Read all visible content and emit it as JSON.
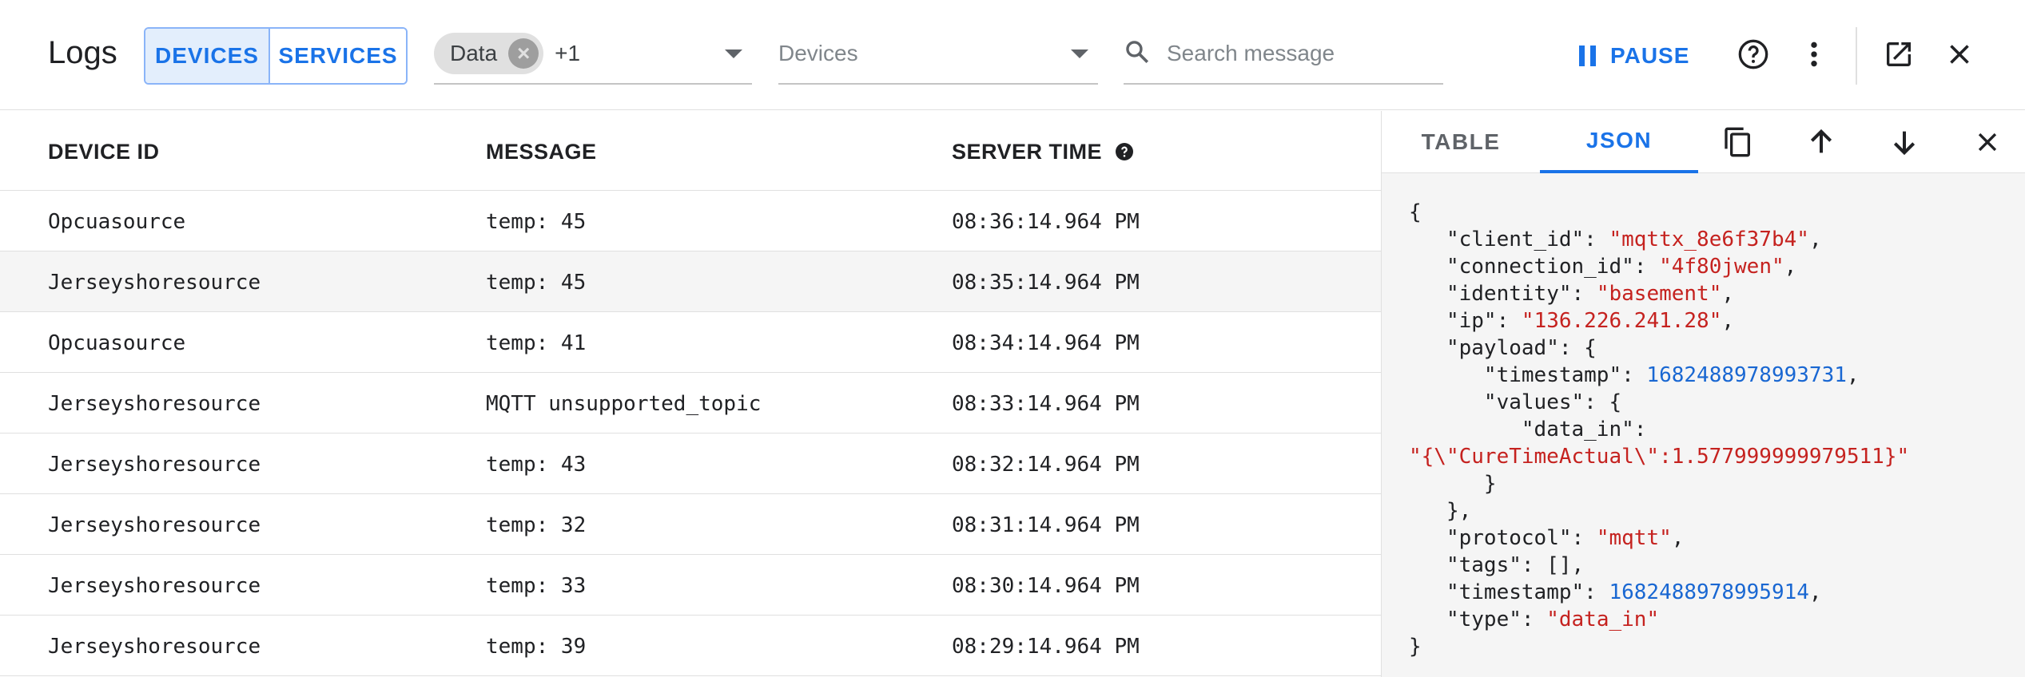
{
  "header": {
    "title": "Logs",
    "toggle": {
      "devices_label": "DEVICES",
      "services_label": "SERVICES",
      "active": "DEVICES"
    },
    "type_filter": {
      "chip_label": "Data",
      "more_count": "+1"
    },
    "device_filter": {
      "placeholder": "Devices"
    },
    "search": {
      "placeholder": "Search message"
    },
    "pause_label": "PAUSE",
    "icons": [
      "help-icon",
      "more-vert-icon",
      "open-in-new-icon",
      "close-icon"
    ]
  },
  "table": {
    "columns": [
      "DEVICE ID",
      "MESSAGE",
      "SERVER TIME"
    ],
    "rows": [
      {
        "device": "Opcuasource",
        "message": "temp: 45",
        "time": "08:36:14.964 PM"
      },
      {
        "device": "Jerseyshoresource",
        "message": "temp: 45",
        "time": "08:35:14.964 PM"
      },
      {
        "device": "Opcuasource",
        "message": "temp: 41",
        "time": "08:34:14.964 PM"
      },
      {
        "device": "Jerseyshoresource",
        "message": "MQTT unsupported_topic",
        "time": "08:33:14.964 PM"
      },
      {
        "device": "Jerseyshoresource",
        "message": "temp: 43",
        "time": "08:32:14.964 PM"
      },
      {
        "device": "Jerseyshoresource",
        "message": "temp: 32",
        "time": "08:31:14.964 PM"
      },
      {
        "device": "Jerseyshoresource",
        "message": "temp: 33",
        "time": "08:30:14.964 PM"
      },
      {
        "device": "Jerseyshoresource",
        "message": "temp: 39",
        "time": "08:29:14.964 PM"
      }
    ],
    "selected_row": 1
  },
  "detail_panel": {
    "tabs": [
      "TABLE",
      "JSON"
    ],
    "active_tab": "JSON",
    "json": {
      "client_id": "mqttx_8e6f37b4",
      "connection_id": "4f80jwen",
      "identity": "basement",
      "ip": "136.226.241.28",
      "payload_timestamp": "1682488978993731",
      "data_in": "\"{\\\"CureTimeActual\\\":1.577999999979511}\"",
      "protocol": "mqtt",
      "tags": "[]",
      "timestamp": "1682488978995914",
      "type": "data_in"
    }
  },
  "colors": {
    "accent": "#1a73e8",
    "string": "#c5221f",
    "number": "#1967d2"
  }
}
